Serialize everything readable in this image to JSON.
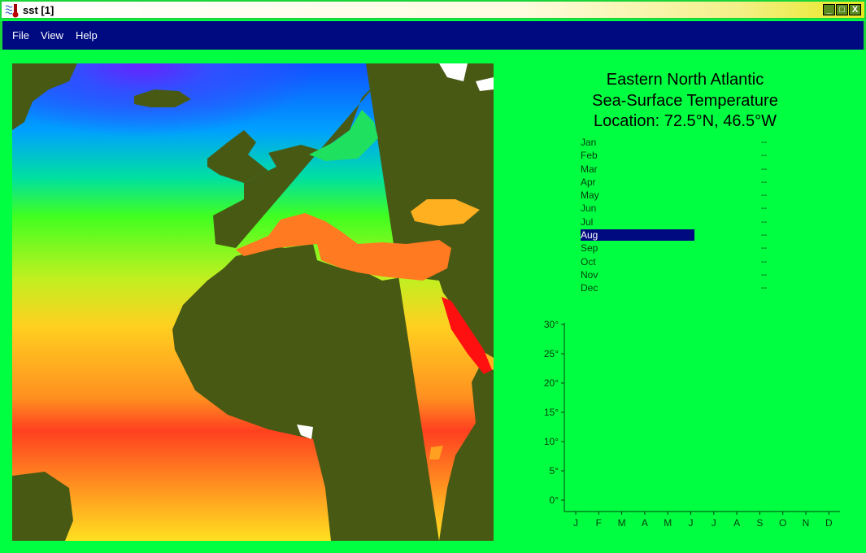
{
  "window": {
    "title": "sst [1]",
    "controls": [
      "_",
      "□",
      "X"
    ]
  },
  "menu": [
    "File",
    "View",
    "Help"
  ],
  "header": {
    "line1": "Eastern North Atlantic",
    "line2": "Sea-Surface Temperature",
    "line3": "Location:  72.5°N, 46.5°W"
  },
  "months": [
    {
      "name": "Jan",
      "value": "--"
    },
    {
      "name": "Feb",
      "value": "--"
    },
    {
      "name": "Mar",
      "value": "--"
    },
    {
      "name": "Apr",
      "value": "--"
    },
    {
      "name": "May",
      "value": "--"
    },
    {
      "name": "Jun",
      "value": "--"
    },
    {
      "name": "Jul",
      "value": "--"
    },
    {
      "name": "Aug",
      "value": "--"
    },
    {
      "name": "Sep",
      "value": "--"
    },
    {
      "name": "Oct",
      "value": "--"
    },
    {
      "name": "Nov",
      "value": "--"
    },
    {
      "name": "Dec",
      "value": "--"
    }
  ],
  "selected_month": "Aug",
  "chart_data": {
    "type": "line",
    "title": "",
    "categories": [
      "J",
      "F",
      "M",
      "A",
      "M",
      "J",
      "J",
      "A",
      "S",
      "O",
      "N",
      "D"
    ],
    "yticks": [
      "30°",
      "25°",
      "20°",
      "15°",
      "10°",
      "5°",
      "0°"
    ],
    "ylim": [
      0,
      30
    ],
    "series": [
      {
        "name": "SST",
        "values": [
          null,
          null,
          null,
          null,
          null,
          null,
          null,
          null,
          null,
          null,
          null,
          null
        ]
      }
    ]
  },
  "colors": {
    "background": "#00ff40",
    "menubar": "#000a80",
    "land": "#485914"
  }
}
